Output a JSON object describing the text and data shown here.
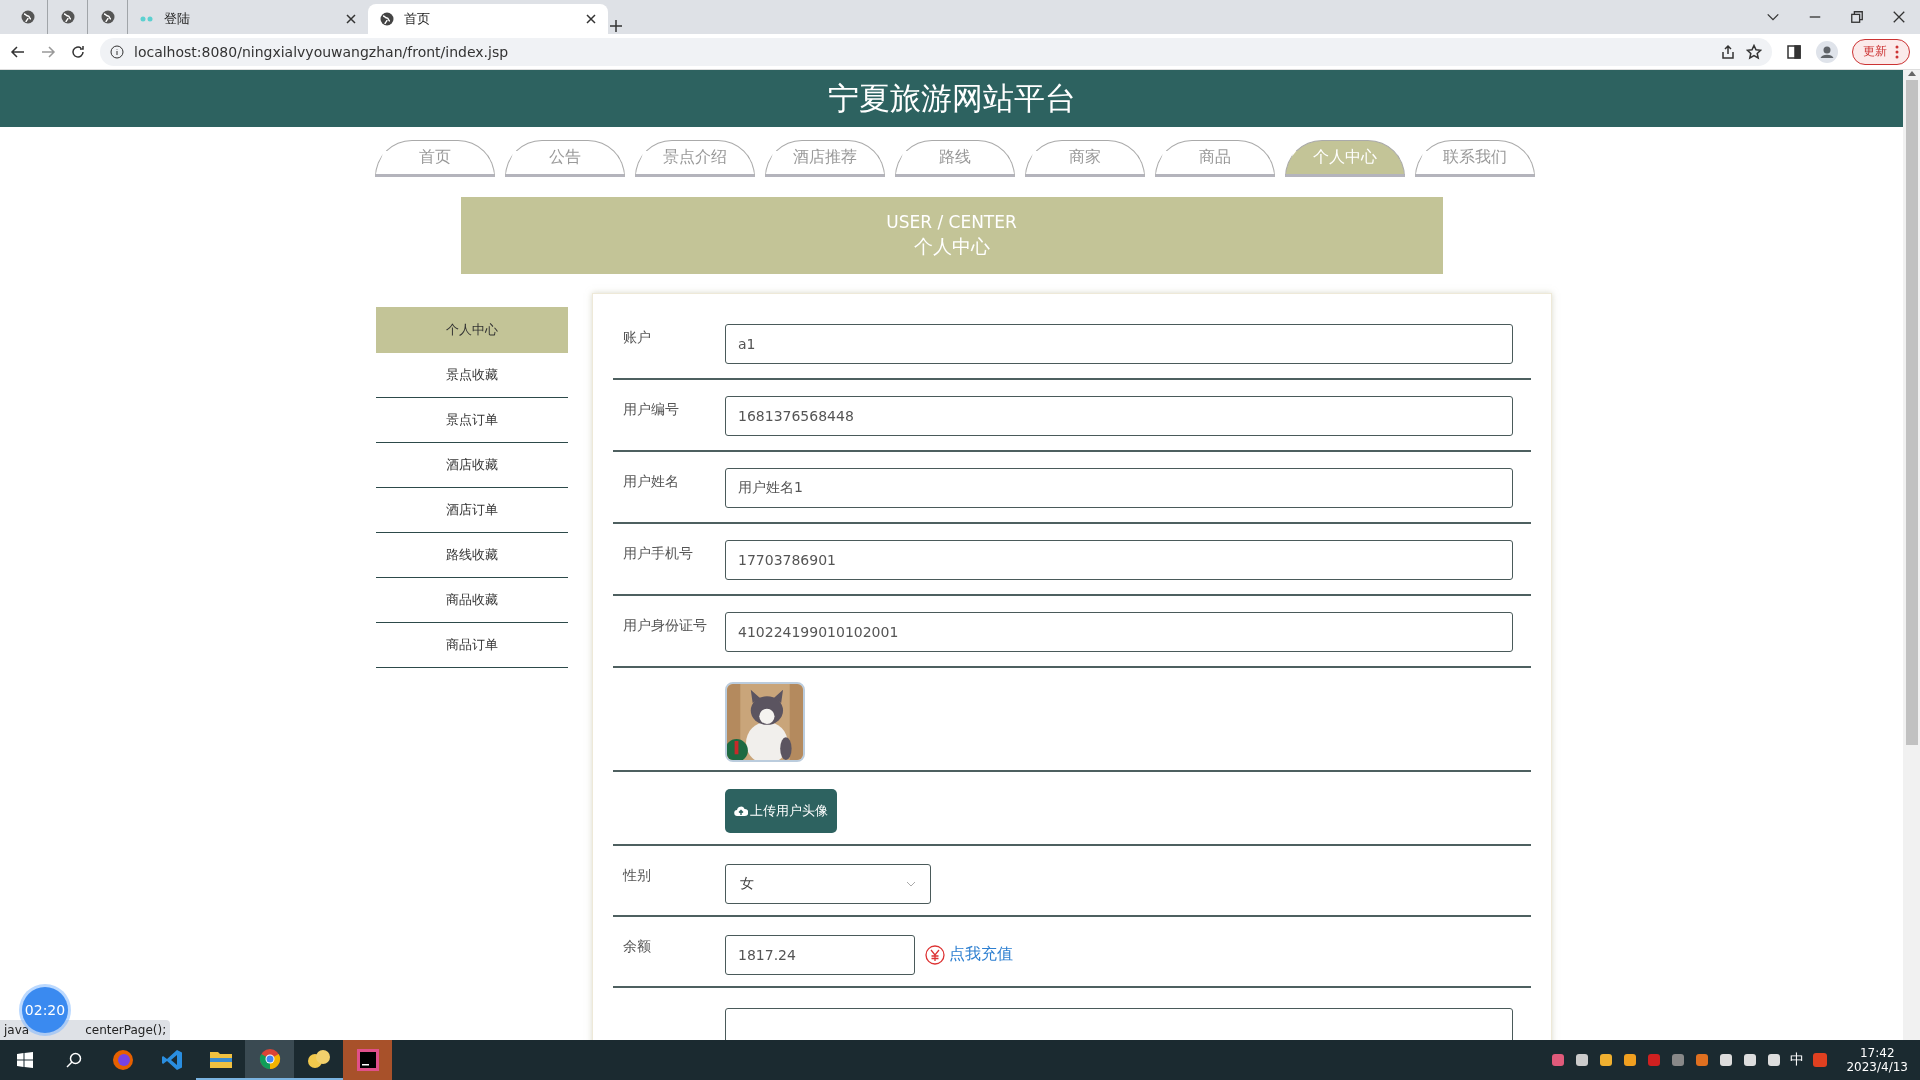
{
  "browser": {
    "tabs": [
      {
        "kind": "pinned",
        "selected": false
      },
      {
        "kind": "pinned",
        "selected": false
      },
      {
        "kind": "pinned",
        "selected": false
      },
      {
        "kind": "tab",
        "title": "登陆",
        "selected": false
      },
      {
        "kind": "tab",
        "title": "首页",
        "selected": true
      }
    ],
    "url": "localhost:8080/ningxialvyouwangzhan/front/index.jsp",
    "update_button": "更新"
  },
  "header": {
    "title": "宁夏旅游网站平台"
  },
  "nav": [
    {
      "label": "首页",
      "selected": false
    },
    {
      "label": "公告",
      "selected": false
    },
    {
      "label": "景点介绍",
      "selected": false
    },
    {
      "label": "酒店推荐",
      "selected": false
    },
    {
      "label": "路线",
      "selected": false
    },
    {
      "label": "商家",
      "selected": false
    },
    {
      "label": "商品",
      "selected": false
    },
    {
      "label": "个人中心",
      "selected": true
    },
    {
      "label": "联系我们",
      "selected": false
    }
  ],
  "banner": {
    "subtitle": "USER / CENTER",
    "title": "个人中心"
  },
  "sidebar": [
    {
      "label": "个人中心",
      "selected": true
    },
    {
      "label": "景点收藏",
      "selected": false
    },
    {
      "label": "景点订单",
      "selected": false
    },
    {
      "label": "酒店收藏",
      "selected": false
    },
    {
      "label": "酒店订单",
      "selected": false
    },
    {
      "label": "路线收藏",
      "selected": false
    },
    {
      "label": "商品收藏",
      "selected": false
    },
    {
      "label": "商品订单",
      "selected": false
    }
  ],
  "form": [
    {
      "kind": "text",
      "label": "账户",
      "value": "a1"
    },
    {
      "kind": "text",
      "label": "用户编号",
      "value": "1681376568448"
    },
    {
      "kind": "text",
      "label": "用户姓名",
      "value": "用户姓名1"
    },
    {
      "kind": "text",
      "label": "用户手机号",
      "value": "17703786901"
    },
    {
      "kind": "text",
      "label": "用户身份证号",
      "value": "410224199010102001"
    },
    {
      "kind": "avatar"
    },
    {
      "kind": "upload",
      "button": "上传用户头像"
    },
    {
      "kind": "select",
      "label": "性别",
      "value": "女"
    },
    {
      "kind": "balance",
      "label": "余额",
      "value": "1817.24",
      "link": "点我充值"
    },
    {
      "kind": "partial"
    }
  ],
  "status_bar": [
    "java",
    "centerPage();"
  ],
  "timer": "02:20",
  "taskbar": {
    "ime": "中",
    "time": "17:42",
    "date": "2023/4/13"
  }
}
